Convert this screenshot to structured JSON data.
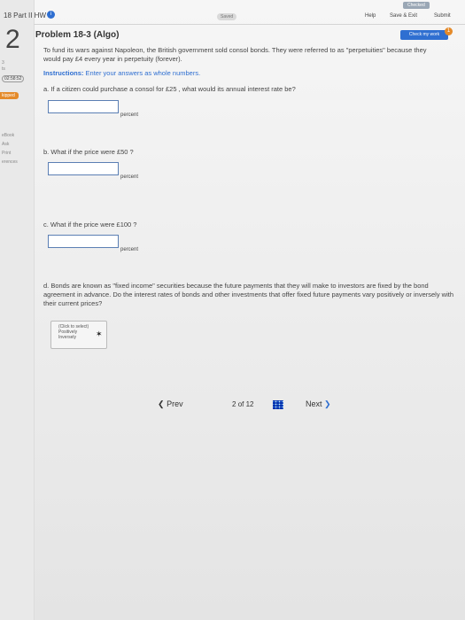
{
  "header": {
    "title": "18 Part II HW",
    "saved": "Saved",
    "help": "Help",
    "save_exit": "Save & Exit",
    "submit": "Submit",
    "check_my_work": "Check my work",
    "check_badge": "1",
    "top_right_badge": "Checked"
  },
  "sidebar": {
    "question_number": "2",
    "points_value": "3",
    "points_label": "ts",
    "timer": "02:58:52",
    "skipped": "kipped",
    "links": [
      "eBook",
      "Ask",
      "Print",
      "erences"
    ]
  },
  "question": {
    "title": "Problem 18-3 (Algo)",
    "intro": "To fund its wars against Napoleon, the British government sold consol bonds. They were referred to as \"perpetuities\" because they would pay £4 every year in perpetuity (forever).",
    "instructions_label": "Instructions:",
    "instructions_text": "Enter your answers as whole numbers.",
    "part_a": "a. If a citizen could purchase a consol for £25 , what would its annual interest rate be?",
    "part_b": "b. What if the price were £50 ?",
    "part_c": "c. What if the price were £100 ?",
    "unit": "percent",
    "part_d": "d. Bonds are known as \"fixed income\" securities because the future payments that they will make to investors are fixed by the bond agreement in advance. Do the interest rates of bonds and other investments that offer fixed future payments vary positively or inversely with their current prices?",
    "select_placeholder": "(Click to select)",
    "select_opt1": "Positively",
    "select_opt2": "Inversely"
  },
  "pager": {
    "prev": "Prev",
    "current": "2",
    "of": "of",
    "total": "12",
    "next": "Next"
  },
  "colors": {
    "accent": "#2f6fd1",
    "green": "#5a9c4a",
    "orange": "#e48a2a",
    "input_border": "#5b7fb4"
  }
}
